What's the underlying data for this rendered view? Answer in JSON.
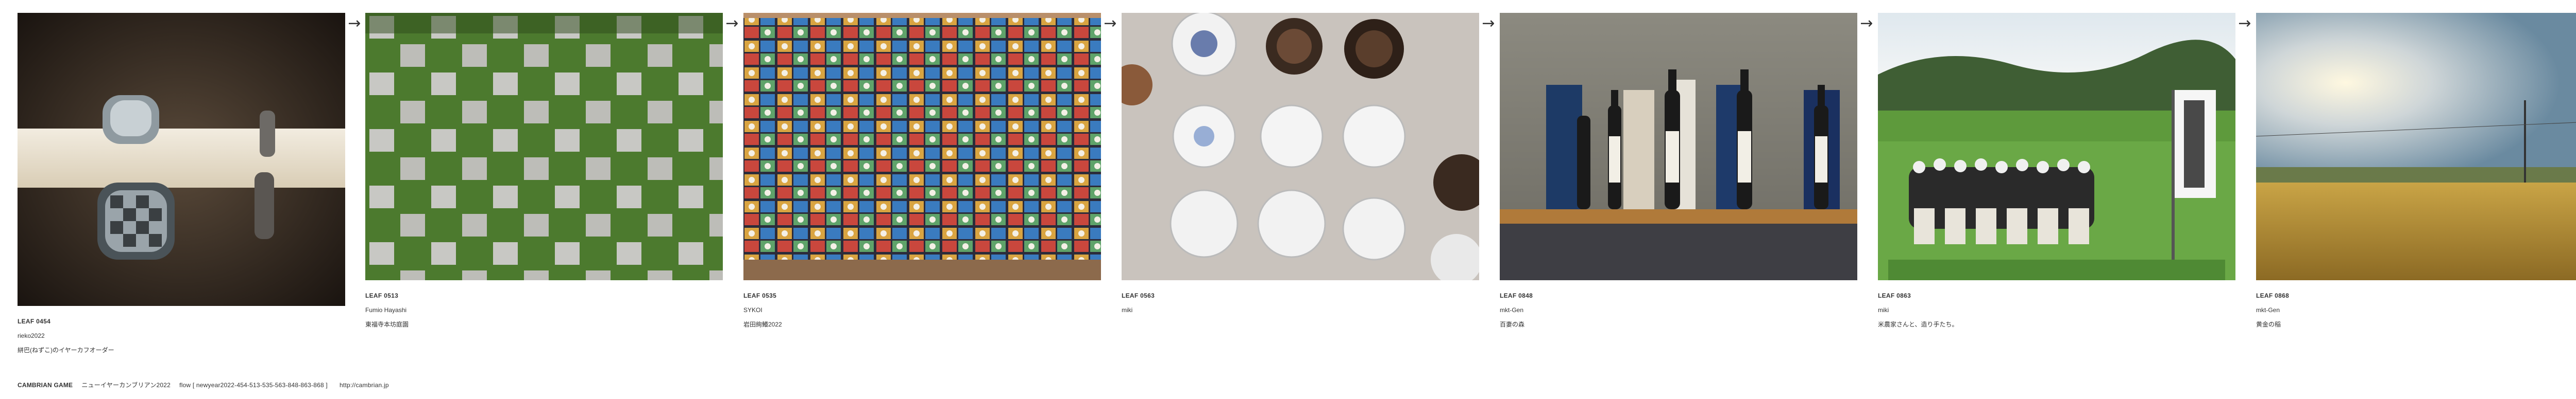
{
  "cards": [
    {
      "leaf": "LEAF 0454",
      "author": "rieko2022",
      "caption": "絣巴(ねずこ)のイヤーカフオーダー",
      "scene": "silver-ring-photo"
    },
    {
      "leaf": "LEAF 0513",
      "author": "Fumio Hayashi",
      "caption": "東福寺本坊庭園",
      "scene": "moss-garden-photo"
    },
    {
      "leaf": "LEAF 0535",
      "author": "SYKOI",
      "caption": "岩田絢鱶2022",
      "scene": "posters-wall-photo"
    },
    {
      "leaf": "LEAF 0563",
      "author": "miki",
      "caption": "",
      "scene": "ceramic-cups-photo"
    },
    {
      "leaf": "LEAF 0848",
      "author": "mkt-Gen",
      "caption": "百妻の森",
      "scene": "sake-bottles-photo"
    },
    {
      "leaf": "LEAF 0863",
      "author": "miki",
      "caption": "米農家さんと、造り手たち。",
      "scene": "group-field-photo"
    },
    {
      "leaf": "LEAF 0868",
      "author": "mkt-Gen",
      "caption": "黄金の稲",
      "scene": "golden-field-photo"
    }
  ],
  "arrows": [
    "→",
    "→",
    "→",
    "→",
    "→",
    "→"
  ],
  "footer": {
    "brand": "CAMBRIAN GAME",
    "title": "ニューイヤーカンブリアン2022",
    "flow": "flow [ newyear2022-454-513-535-563-848-863-868 ]",
    "url": "http://cambrian.jp"
  }
}
